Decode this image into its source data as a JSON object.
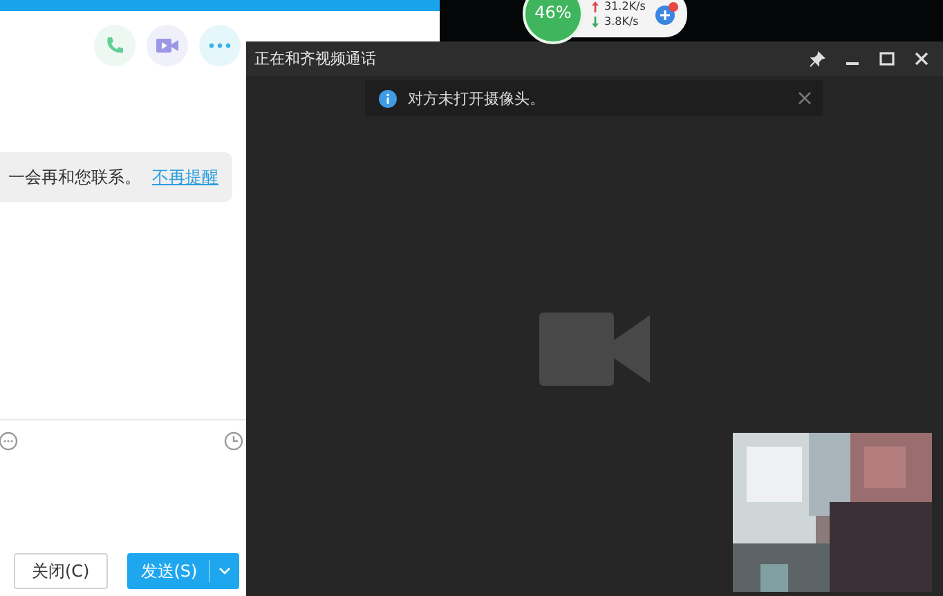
{
  "chat": {
    "message": {
      "text": "一会再和您联系。",
      "link": "不再提醒"
    },
    "buttons": [
      {
        "label": "关闭(C)",
        "kind": "plain"
      },
      {
        "label": "发送(S)",
        "kind": "primary"
      }
    ]
  },
  "speed_widget": {
    "percent": "46%",
    "upload": "31.2K/s",
    "download": "3.8K/s"
  },
  "video_window": {
    "title": "正在和齐视频通话",
    "notice": "对方未打开摄像头。"
  }
}
